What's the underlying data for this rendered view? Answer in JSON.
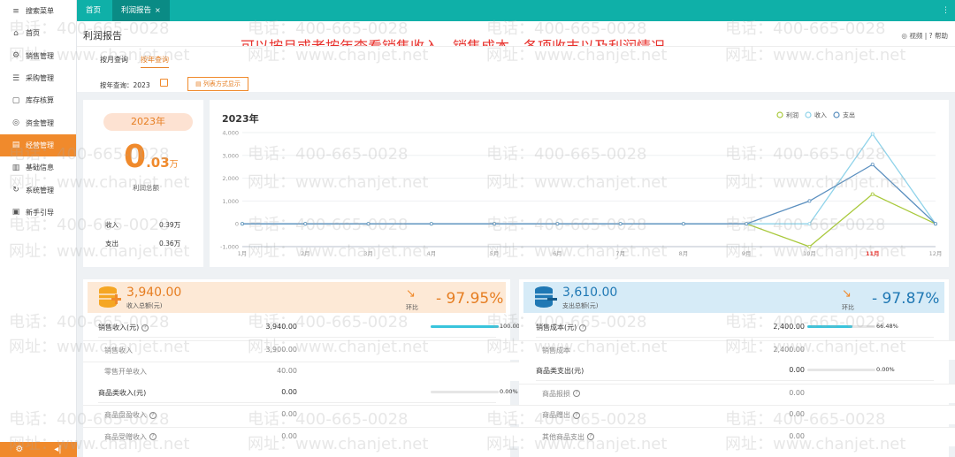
{
  "sidebar": {
    "items": [
      {
        "icon": "≡",
        "label": "搜索菜单"
      },
      {
        "icon": "⌂",
        "label": "首页"
      },
      {
        "icon": "⚙",
        "label": "销售管理"
      },
      {
        "icon": "☰",
        "label": "采购管理"
      },
      {
        "icon": "▢",
        "label": "库存核算"
      },
      {
        "icon": "◎",
        "label": "资金管理"
      },
      {
        "icon": "▤",
        "label": "经营管理"
      },
      {
        "icon": "▥",
        "label": "基础信息"
      },
      {
        "icon": "↻",
        "label": "系统管理"
      },
      {
        "icon": "▣",
        "label": "新手引导"
      }
    ],
    "active_index": 6,
    "bottom_left_icon": "gear-icon",
    "bottom_right_icon": "collapse-icon"
  },
  "tabs": [
    {
      "label": "首页",
      "active": false
    },
    {
      "label": "利润报告",
      "active": true,
      "close": "×"
    }
  ],
  "header": {
    "title": "利润报告",
    "annotation": "可以按月或者按年查看销售收入，销售成本，各项收支以及利润情况",
    "video": "◎ 视频",
    "help": "? 帮助"
  },
  "subtabs": [
    {
      "label": "按月查询",
      "active": false
    },
    {
      "label": "按年查询",
      "active": true
    }
  ],
  "query": {
    "label": "按年查询：2023",
    "list_button": "列表方式显示"
  },
  "profit_card": {
    "year": "2023年",
    "value_int": "0",
    "value_dec": ".03",
    "value_unit": "万",
    "label": "利润总额",
    "income_label": "收入",
    "income_value": "0.39万",
    "expense_label": "支出",
    "expense_value": "0.36万"
  },
  "chart_data": {
    "type": "line",
    "title": "2023年",
    "categories": [
      "1月",
      "2月",
      "3月",
      "4月",
      "5月",
      "6月",
      "7月",
      "8月",
      "9月",
      "10月",
      "11月",
      "12月"
    ],
    "highlight_category": "11月",
    "y_ticks": [
      "4,000",
      "3,000",
      "2,000",
      "1,000",
      "0",
      "-1,000"
    ],
    "ylim": [
      -1000,
      4000
    ],
    "legend_position": "top-right",
    "series": [
      {
        "name": "利润",
        "color": "#a9c93c",
        "values": [
          0,
          0,
          0,
          0,
          0,
          0,
          0,
          0,
          0,
          -1000,
          1300,
          0
        ]
      },
      {
        "name": "收入",
        "color": "#8fd3ea",
        "values": [
          0,
          0,
          0,
          0,
          0,
          0,
          0,
          0,
          0,
          0,
          3940,
          0
        ]
      },
      {
        "name": "支出",
        "color": "#5a8fbf",
        "values": [
          0,
          0,
          0,
          0,
          0,
          0,
          0,
          0,
          0,
          1000,
          2600,
          0
        ]
      }
    ]
  },
  "income_summary": {
    "value": "3,940.00",
    "label": "收入总额(元)",
    "trend_label": "环比",
    "pct": "- 97.95%",
    "color": "#f08a2c",
    "bg": "#fde9d6"
  },
  "expense_summary": {
    "value": "3,610.00",
    "label": "支出总额(元)",
    "trend_label": "环比",
    "pct": "- 97.87%",
    "color": "#1f78b4",
    "bg": "#d6ebf7"
  },
  "income_rows": [
    {
      "label": "销售收入(元)",
      "value": "3,940.00",
      "help": true,
      "bar": 1.0,
      "pct": "100.00%",
      "sub": false
    },
    {
      "label": "销售收入",
      "value": "3,900.00",
      "help": false,
      "sub": true
    },
    {
      "label": "零售开单收入",
      "value": "40.00",
      "help": false,
      "sub": true
    },
    {
      "label": "商品类收入(元)",
      "value": "0.00",
      "help": false,
      "bar": 0.0,
      "pct": "0.00%",
      "sub": false
    },
    {
      "label": "商品盘盈收入",
      "value": "0.00",
      "help": true,
      "sub": true
    },
    {
      "label": "商品受赠收入",
      "value": "0.00",
      "help": true,
      "sub": true
    }
  ],
  "expense_rows": [
    {
      "label": "销售成本(元)",
      "value": "2,400.00",
      "help": true,
      "bar": 0.6648,
      "pct": "66.48%",
      "sub": false
    },
    {
      "label": "销售成本",
      "value": "2,400.00",
      "help": false,
      "sub": true
    },
    {
      "label": "商品类支出(元)",
      "value": "0.00",
      "help": false,
      "bar": 0.0,
      "pct": "0.00%",
      "sub": false
    },
    {
      "label": "商品报损",
      "value": "0.00",
      "help": true,
      "sub": true
    },
    {
      "label": "商品赠出",
      "value": "0.00",
      "help": true,
      "sub": true
    },
    {
      "label": "其他商品支出",
      "value": "0.00",
      "help": true,
      "sub": true
    }
  ],
  "watermark": {
    "phone": "电话：400-665-0028",
    "site": "网址：www.chanjet.net"
  }
}
